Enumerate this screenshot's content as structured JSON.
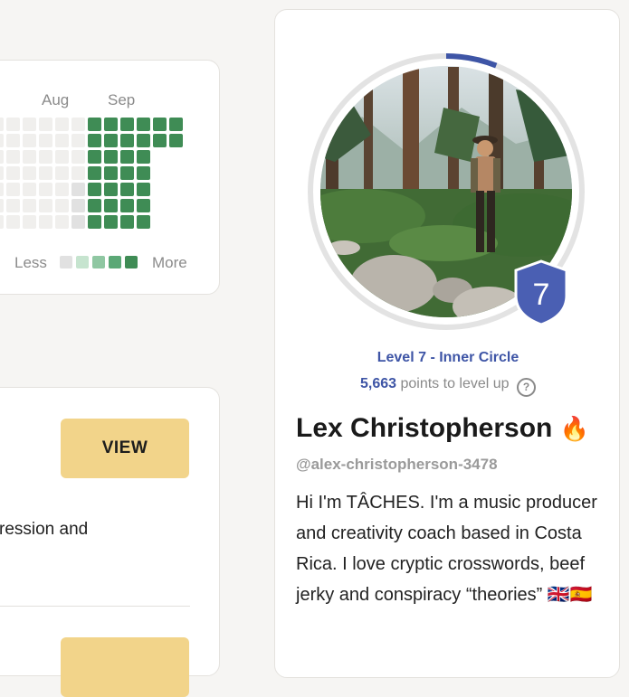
{
  "activity": {
    "months": [
      "Aug",
      "Sep"
    ],
    "legend": {
      "less": "Less",
      "more": "More"
    },
    "colors": {
      "empty": "#f0efed",
      "gray": "#e1e1e1",
      "l1": "#c6e4cf",
      "l2": "#8fc7a2",
      "l3": "#5ba876",
      "l4": "#3f8c55"
    }
  },
  "challenge": {
    "view_label": "VIEW",
    "description_fragment": "ression and"
  },
  "profile": {
    "level_title": "Level 7 - Inner Circle",
    "points_number": "5,663",
    "points_text": "points to level up",
    "help_glyph": "?",
    "level_badge": "7",
    "level_progress_fraction": 0.06,
    "name": "Lex Christopherson",
    "name_emoji": "🔥",
    "handle": "@alex-christopherson-3478",
    "bio": "Hi I'm TÂCHES. I'm a music producer and creativity coach based in Costa Rica. I love cryptic crosswords, beef jerky and conspiracy “theories” 🇬🇧🇪🇸",
    "accent": "#3e55a6"
  }
}
